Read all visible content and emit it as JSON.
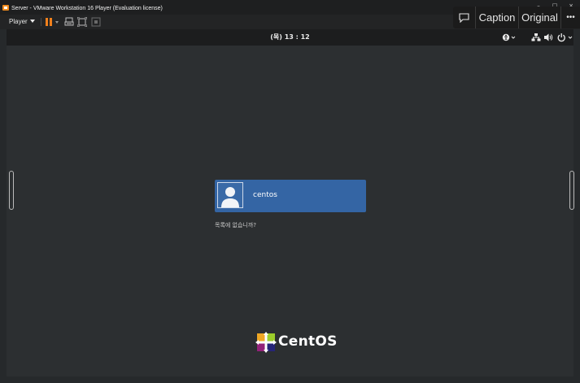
{
  "window": {
    "title": "Server - VMware Workstation 16 Player (Evaluation license)"
  },
  "toolbar": {
    "player_menu": "Player"
  },
  "overlay": {
    "chat_icon": "chat-bubble-icon",
    "caption_label": "Caption",
    "original_label": "Original",
    "more_label": "•••"
  },
  "guest": {
    "clock": "(목) 13 : 12",
    "login": {
      "username": "centos",
      "not_listed": "목록에 없습니까?"
    },
    "brand": "CentOS"
  },
  "colors": {
    "accent": "#3465a4",
    "pause": "#f0801c",
    "background": "#2c2f31"
  }
}
